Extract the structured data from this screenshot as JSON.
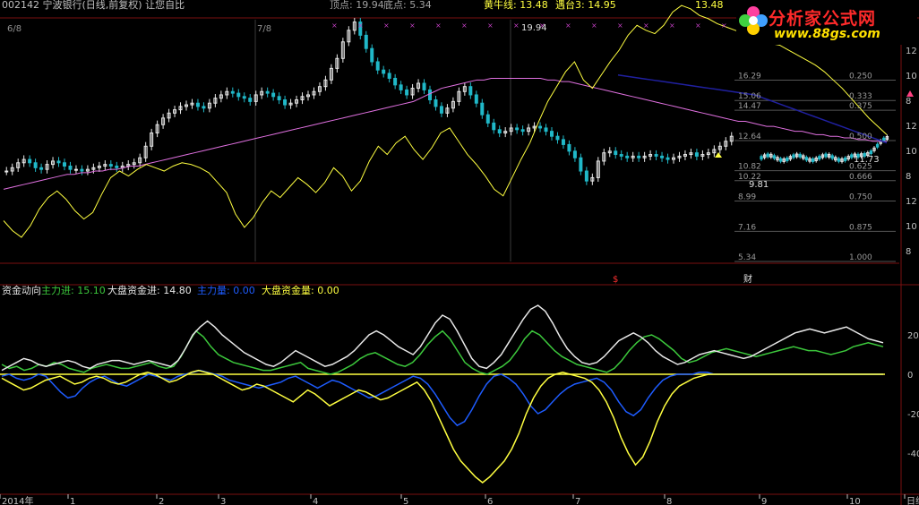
{
  "header": {
    "stock": "002142 宁波银行(日线,前复权) 让您自比",
    "high": "顶点: 19.94",
    "low": "底点: 5.34",
    "yellow_line": "黄牛线: 13.48",
    "top3": "遇台3: 14.95",
    "extra": "13.48"
  },
  "colors": {
    "white": "#e8e8e8",
    "yellow": "#ffff40",
    "magenta": "#e070e0",
    "navy": "#2020a0",
    "blue": "#1e5cff",
    "green": "#3cc83c",
    "up": "#ff4040",
    "down": "#20b8c8"
  },
  "panel2_header": {
    "title": "资金动向",
    "main_in": "主力进: 15.10",
    "market_in": "大盘资金进: 14.80",
    "main_vol": "主力量: 0.00",
    "market_vol": "大盘资金量: 0.00"
  },
  "markers": {
    "dollar": "$",
    "fin": "财"
  },
  "logo": {
    "title": "分析家公式网",
    "url": "www.88gs.com",
    "icon": "flower-icon"
  },
  "top_labels": {
    "d1": "6/8",
    "d2": "7/8",
    "peak": "19.94",
    "trough": "9.81",
    "last": "11.73"
  },
  "chart_data": [
    {
      "type": "line",
      "panel": "price",
      "y_ticks": [
        "12",
        "10",
        "8",
        "12",
        "10",
        "8",
        "12",
        "10",
        "8"
      ],
      "fib_levels": [
        {
          "price": "16.29",
          "ratio": "0.250"
        },
        {
          "price": "15.06",
          "ratio": "0.333"
        },
        {
          "price": "14.47",
          "ratio": "0.375"
        },
        {
          "price": "12.64",
          "ratio": "0.500"
        },
        {
          "price": "10.82",
          "ratio": "0.625"
        },
        {
          "price": "10.22",
          "ratio": "0.666"
        },
        {
          "price": "8.99",
          "ratio": "0.750"
        },
        {
          "price": "7.16",
          "ratio": "0.875"
        },
        {
          "price": "5.34",
          "ratio": "1.000"
        }
      ],
      "price_range": [
        5.34,
        19.94
      ],
      "series": [
        {
          "name": "close",
          "values": [
            10.8,
            11.0,
            11.3,
            11.5,
            11.3,
            11.0,
            10.9,
            11.2,
            11.4,
            11.3,
            11.1,
            10.9,
            10.9,
            10.8,
            10.9,
            11.0,
            11.1,
            11.2,
            11.1,
            11.0,
            11.1,
            11.2,
            11.3,
            11.6,
            12.3,
            13.1,
            13.6,
            14.0,
            14.3,
            14.5,
            14.7,
            14.8,
            14.9,
            14.7,
            14.6,
            14.9,
            15.2,
            15.4,
            15.6,
            15.5,
            15.3,
            15.2,
            15.0,
            15.4,
            15.6,
            15.5,
            15.3,
            15.1,
            14.8,
            14.9,
            15.1,
            15.3,
            15.4,
            15.6,
            15.9,
            16.3,
            17.0,
            17.6,
            18.6,
            19.3,
            19.8,
            19.0,
            18.2,
            17.4,
            16.9,
            16.7,
            16.4,
            16.0,
            15.7,
            15.4,
            15.8,
            16.1,
            15.7,
            15.1,
            14.7,
            14.3,
            14.6,
            15.0,
            15.6,
            15.9,
            15.4,
            14.9,
            14.2,
            13.7,
            13.3,
            13.1,
            13.2,
            13.4,
            13.3,
            13.2,
            13.4,
            13.5,
            13.4,
            13.2,
            12.9,
            12.7,
            12.4,
            12.0,
            11.6,
            10.8,
            10.2,
            10.4,
            11.4,
            11.9,
            12.0,
            11.8,
            11.7,
            11.6,
            11.7,
            11.6,
            11.7,
            11.8,
            11.7,
            11.6,
            11.5,
            11.6,
            11.7,
            11.8,
            11.9,
            11.7,
            11.8,
            11.9,
            12.1,
            12.3,
            12.6,
            12.9
          ]
        },
        {
          "name": "ma",
          "values": [
            9.7,
            9.8,
            9.9,
            10.0,
            10.1,
            10.2,
            10.3,
            10.4,
            10.5,
            10.6,
            10.6,
            10.7,
            10.7,
            10.8,
            10.8,
            10.9,
            10.9,
            11.0,
            11.1,
            11.1,
            11.2,
            11.3,
            11.4,
            11.5,
            11.6,
            11.7,
            11.8,
            11.9,
            12.0,
            12.1,
            12.2,
            12.3,
            12.4,
            12.5,
            12.6,
            12.7,
            12.8,
            12.9,
            13.0,
            13.1,
            13.2,
            13.3,
            13.4,
            13.5,
            13.6,
            13.7,
            13.8,
            13.9,
            14.0,
            14.1,
            14.2,
            14.3,
            14.4,
            14.5,
            14.6,
            14.7,
            14.8,
            14.9,
            15.0,
            15.2,
            15.4,
            15.6,
            15.8,
            15.9,
            16.0,
            16.1,
            16.2,
            16.3,
            16.3,
            16.4,
            16.4,
            16.4,
            16.4,
            16.4,
            16.4,
            16.4,
            16.4,
            16.3,
            16.3,
            16.2,
            16.2,
            16.1,
            16.0,
            15.9,
            15.8,
            15.7,
            15.6,
            15.5,
            15.4,
            15.3,
            15.2,
            15.1,
            15.0,
            14.9,
            14.8,
            14.7,
            14.6,
            14.5,
            14.4,
            14.3,
            14.2,
            14.1,
            14.0,
            13.9,
            13.8,
            13.8,
            13.7,
            13.6,
            13.5,
            13.5,
            13.4,
            13.3,
            13.2,
            13.2,
            13.1,
            13.0,
            13.0,
            12.9,
            12.9,
            12.8,
            12.8,
            12.7,
            12.7,
            12.6,
            12.6,
            12.6
          ]
        },
        {
          "name": "oscillator",
          "values": [
            7.8,
            7.2,
            6.8,
            7.5,
            8.5,
            9.2,
            9.6,
            9.1,
            8.4,
            7.9,
            8.3,
            9.4,
            10.4,
            10.8,
            10.5,
            10.9,
            11.2,
            11.0,
            10.8,
            11.1,
            11.3,
            11.2,
            11.0,
            10.7,
            10.1,
            9.5,
            8.2,
            7.4,
            8.0,
            8.9,
            9.6,
            9.2,
            9.8,
            10.4,
            10.0,
            9.5,
            10.1,
            11.0,
            10.5,
            9.6,
            10.2,
            11.4,
            12.3,
            11.8,
            12.5,
            12.9,
            12.1,
            11.5,
            12.2,
            13.1,
            13.4,
            12.6,
            11.8,
            11.2,
            10.5,
            9.7,
            9.3,
            10.4,
            11.5,
            12.5,
            13.8,
            15.0,
            15.9,
            16.8,
            17.4,
            16.3,
            15.8,
            16.6,
            17.4,
            18.1,
            19.0,
            19.6,
            19.3,
            19.1,
            19.6,
            20.4,
            20.8,
            20.6,
            20.2,
            20.0,
            19.7,
            19.5,
            19.3,
            19.1,
            18.9,
            18.7,
            18.5,
            18.4,
            18.1,
            17.8,
            17.5,
            17.2,
            16.8,
            16.3,
            15.8,
            15.2,
            14.6,
            14.0,
            13.5,
            13.0
          ]
        }
      ]
    },
    {
      "type": "line",
      "panel": "capital_flow",
      "y_ticks": [
        "20",
        "0",
        "-20",
        "-40"
      ],
      "x_labels": [
        "2014年",
        "1",
        "2",
        "3",
        "4",
        "5",
        "6",
        "7",
        "8",
        "9",
        "10",
        "日线"
      ],
      "series": [
        {
          "name": "主力进",
          "values": [
            5,
            3,
            4,
            2,
            3,
            5,
            4,
            6,
            5,
            3,
            2,
            1,
            3,
            4,
            5,
            4,
            3,
            3,
            4,
            5,
            6,
            4,
            3,
            4,
            9,
            16,
            22,
            19,
            14,
            10,
            8,
            6,
            5,
            4,
            3,
            2,
            2,
            3,
            4,
            5,
            6,
            3,
            2,
            1,
            0,
            1,
            3,
            5,
            8,
            10,
            11,
            9,
            7,
            5,
            4,
            6,
            10,
            15,
            19,
            22,
            18,
            12,
            6,
            3,
            1,
            0,
            2,
            4,
            7,
            12,
            18,
            22,
            20,
            16,
            12,
            9,
            7,
            5,
            4,
            3,
            2,
            1,
            3,
            7,
            12,
            16,
            19,
            20,
            18,
            15,
            12,
            8,
            6,
            7,
            9,
            11,
            12,
            13,
            12,
            11,
            10,
            9,
            10,
            11,
            12,
            13,
            14,
            13,
            12,
            12,
            11,
            10,
            11,
            12,
            14,
            15,
            16,
            15,
            14
          ]
        },
        {
          "name": "大盘资金进",
          "values": [
            2,
            4,
            6,
            8,
            7,
            5,
            4,
            5,
            6,
            7,
            6,
            4,
            3,
            5,
            6,
            7,
            7,
            6,
            5,
            6,
            7,
            6,
            5,
            4,
            7,
            13,
            20,
            24,
            27,
            24,
            20,
            17,
            14,
            11,
            9,
            7,
            5,
            4,
            6,
            9,
            12,
            10,
            8,
            6,
            4,
            5,
            7,
            9,
            12,
            16,
            20,
            22,
            20,
            17,
            14,
            12,
            10,
            14,
            20,
            26,
            30,
            28,
            22,
            15,
            8,
            4,
            3,
            6,
            10,
            16,
            22,
            28,
            33,
            35,
            32,
            26,
            19,
            13,
            9,
            6,
            5,
            6,
            9,
            13,
            17,
            19,
            21,
            19,
            16,
            12,
            9,
            7,
            5,
            6,
            8,
            10,
            11,
            12,
            11,
            10,
            9,
            8,
            9,
            11,
            13,
            15,
            17,
            19,
            21,
            22,
            23,
            22,
            21,
            22,
            23,
            24,
            22,
            20,
            18,
            17,
            16
          ]
        },
        {
          "name": "主力量",
          "values": [
            -1,
            0,
            -2,
            -3,
            -2,
            0,
            -1,
            -5,
            -9,
            -12,
            -11,
            -7,
            -4,
            -2,
            -1,
            -3,
            -5,
            -6,
            -4,
            -2,
            0,
            -1,
            -2,
            -3,
            -1,
            0,
            1,
            2,
            1,
            0,
            -1,
            -3,
            -4,
            -5,
            -6,
            -7,
            -6,
            -5,
            -4,
            -2,
            -1,
            -3,
            -5,
            -7,
            -5,
            -3,
            -4,
            -6,
            -8,
            -10,
            -12,
            -11,
            -9,
            -7,
            -5,
            -3,
            -1,
            -2,
            -5,
            -10,
            -16,
            -22,
            -26,
            -24,
            -18,
            -11,
            -5,
            -1,
            0,
            -2,
            -5,
            -10,
            -16,
            -20,
            -18,
            -14,
            -10,
            -7,
            -5,
            -4,
            -3,
            -2,
            -4,
            -8,
            -14,
            -19,
            -21,
            -18,
            -12,
            -7,
            -3,
            -1,
            0,
            0,
            0,
            1,
            1,
            0,
            0,
            0,
            0,
            0,
            0,
            0,
            0,
            0,
            0,
            0,
            0,
            0,
            0,
            0,
            0,
            0,
            0,
            0,
            0,
            0,
            0,
            0,
            0
          ]
        },
        {
          "name": "大盘资金量",
          "values": [
            -2,
            -4,
            -6,
            -8,
            -7,
            -5,
            -3,
            -2,
            -1,
            -3,
            -5,
            -4,
            -2,
            -1,
            -2,
            -4,
            -5,
            -4,
            -2,
            0,
            1,
            0,
            -2,
            -4,
            -3,
            -1,
            1,
            2,
            1,
            0,
            -2,
            -4,
            -6,
            -8,
            -7,
            -5,
            -6,
            -8,
            -10,
            -12,
            -14,
            -11,
            -8,
            -10,
            -13,
            -16,
            -14,
            -12,
            -10,
            -8,
            -9,
            -11,
            -13,
            -12,
            -10,
            -8,
            -6,
            -4,
            -8,
            -14,
            -22,
            -30,
            -38,
            -44,
            -48,
            -52,
            -55,
            -52,
            -48,
            -44,
            -38,
            -30,
            -20,
            -12,
            -6,
            -2,
            0,
            1,
            0,
            -1,
            -2,
            -4,
            -8,
            -14,
            -22,
            -32,
            -40,
            -46,
            -42,
            -34,
            -24,
            -16,
            -10,
            -6,
            -4,
            -2,
            -1,
            0,
            0,
            0,
            0,
            0,
            0,
            0,
            0,
            0,
            0,
            0,
            0,
            0,
            0,
            0,
            0,
            0,
            0,
            0,
            0,
            0,
            0,
            0,
            0,
            0
          ]
        }
      ]
    }
  ]
}
